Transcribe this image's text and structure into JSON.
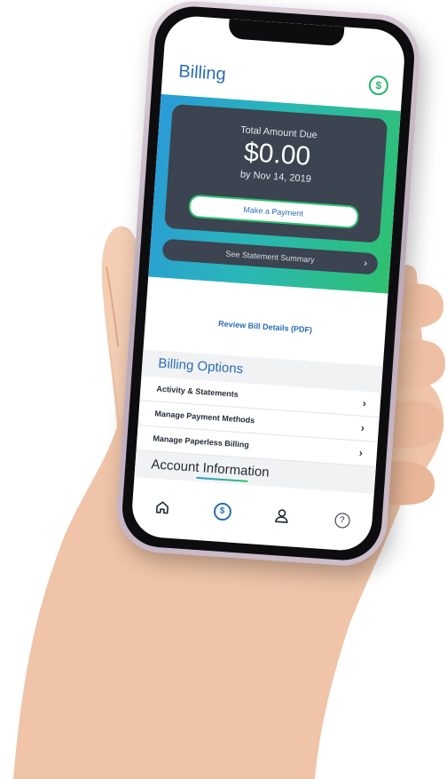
{
  "header": {
    "title": "Billing",
    "dollar_symbol": "$"
  },
  "summary": {
    "label": "Total Amount Due",
    "amount": "$0.00",
    "due_date": "by Nov 14, 2019",
    "pay_button": "Make a Payment",
    "statement_summary": "See Statement Summary",
    "chevron": "›"
  },
  "review_link": "Review Bill Details (PDF)",
  "billing_options": {
    "heading": "Billing Options",
    "items": [
      {
        "label": "Activity & Statements"
      },
      {
        "label": "Manage Payment Methods"
      },
      {
        "label": "Manage Paperless Billing"
      }
    ],
    "chevron": "›"
  },
  "account_heading": "Account Information",
  "tabs": [
    {
      "icon": "home-icon"
    },
    {
      "icon": "dollar-icon",
      "symbol": "$"
    },
    {
      "icon": "user-icon"
    },
    {
      "icon": "help-icon",
      "symbol": "?"
    }
  ],
  "colors": {
    "accent_blue": "#2a6db3",
    "accent_green": "#2fc06f",
    "card": "#3b4450"
  }
}
